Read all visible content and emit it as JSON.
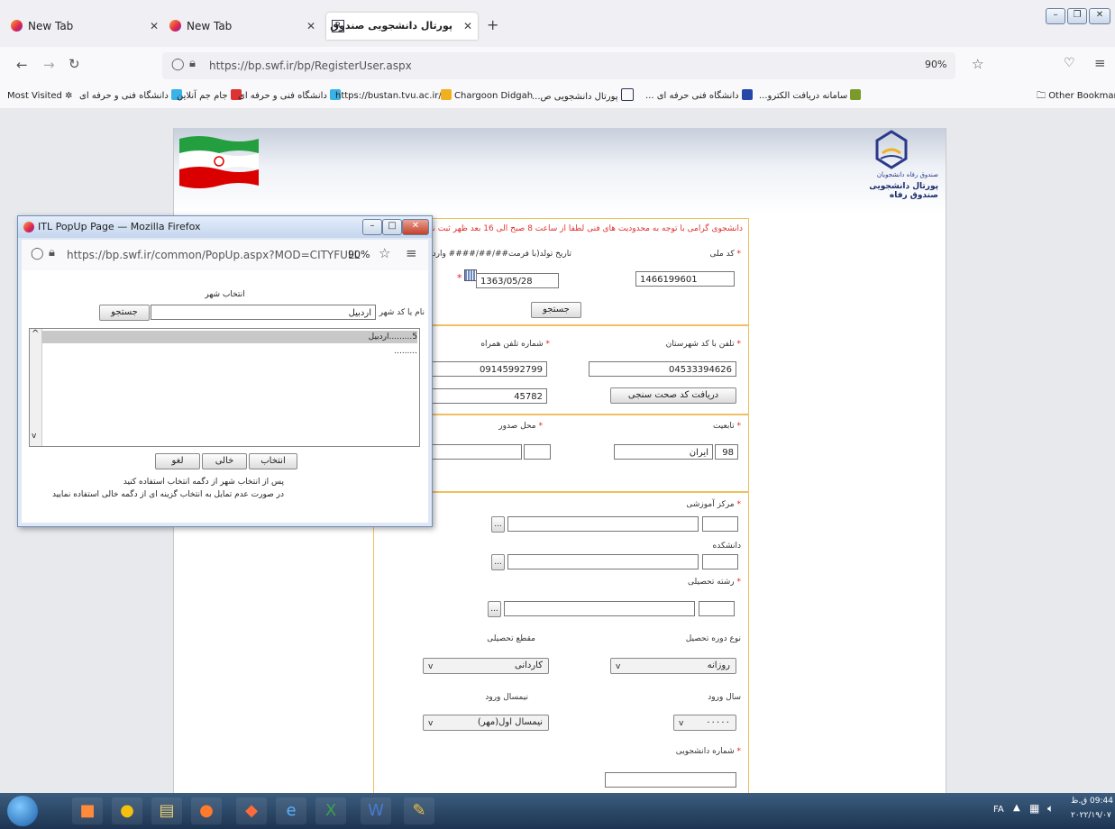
{
  "browser": {
    "tabs": [
      {
        "title": "New Tab"
      },
      {
        "title": "New Tab"
      },
      {
        "title": "پورتال دانشجویی صندوق رفاه"
      }
    ],
    "url": "https://bp.swf.ir/bp/RegisterUser.aspx",
    "zoom": "90%",
    "bookmarks": {
      "most_visited": "Most Visited",
      "items": [
        "دانشگاه فنی و حرفه ای",
        "جام جم آنلاین",
        "دانشگاه فنی و حرفه ای",
        "https://bustan.tvu.ac.ir/",
        "Chargoon Didgah",
        "پورتال دانشجویی ص...",
        "دانشگاه فنی حرفه ای ...",
        "سامانه دریافت الکترو..."
      ],
      "other": "Other Bookmarks"
    }
  },
  "form": {
    "notice": "دانشجوی گرامی با توجه به محدودیت های فنی لطفا از ساعت 8 صبح الی 16 بعد ظهر ثبت نام نمایید",
    "national_code_label": "کد ملی",
    "national_code_value": "1466199601",
    "birth_label": "تاریخ تولد(با فرمت##/##/#### وارد گ",
    "birth_value": "1363/05/28",
    "search_button": "جستجو",
    "city_phone_label": "تلفن با کد شهرستان",
    "city_phone_value": "04533394626",
    "mobile_label": "شماره تلفن همراه",
    "mobile_value": "09145992799",
    "verify_button": "دریافت کد صحت سنجی",
    "verify_value": "45782",
    "nationality_label": "تابعیت",
    "nationality_code": "98",
    "nationality_name": "ایران",
    "issue_place_label": "محل صدور",
    "edu_center_label": "مرکز آموزشی",
    "faculty_label": "دانشکده",
    "major_label": "رشته تحصیلی",
    "dots": "...",
    "course_type_label": "نوع دوره تحصیل",
    "course_type_value": "روزانه",
    "degree_label": "مقطع تحصیلی",
    "degree_value": "کاردانی",
    "entry_year_label": "سال ورود",
    "entry_year_value": "۰۰۰۰۰",
    "entry_term_label": "نیمسال ورود",
    "entry_term_value": "نیمسال اول(مهر)",
    "student_no_label": "شماره دانشجویی",
    "logo_text": "پورتال دانشجویی صندوق رفاه",
    "logo_subtext": "صندوق رفاه دانشجویان"
  },
  "popup": {
    "title": "ITL PopUp Page — Mozilla Firefox",
    "url": "https://bp.swf.ir/common/PopUp.aspx?MOD=CITYFULL",
    "zoom": "90%",
    "heading": "انتخاب شهر",
    "name_label": "نام یا کد شهر",
    "search_value": "اردبیل",
    "search_button": "جستجو",
    "list_items": [
      "5.........اردبیل",
      "........."
    ],
    "select_button": "انتخاب",
    "empty_button": "خالی",
    "cancel_button": "لغو",
    "help_line1": "پس از انتخاب شهر از دگمه انتخاب استفاده کنید",
    "help_line2": "در صورت عدم تمایل به انتخاب گزینه ای از دگمه خالی استفاده نمایید"
  },
  "taskbar": {
    "lang": "FA",
    "time": "09:44 ق.ظ",
    "date": "۲۰۲۲/۱۹/۰۷"
  },
  "colors": {
    "accent_border": "#f0c060",
    "required": "#e02020",
    "taskbar": "#1d3552"
  }
}
